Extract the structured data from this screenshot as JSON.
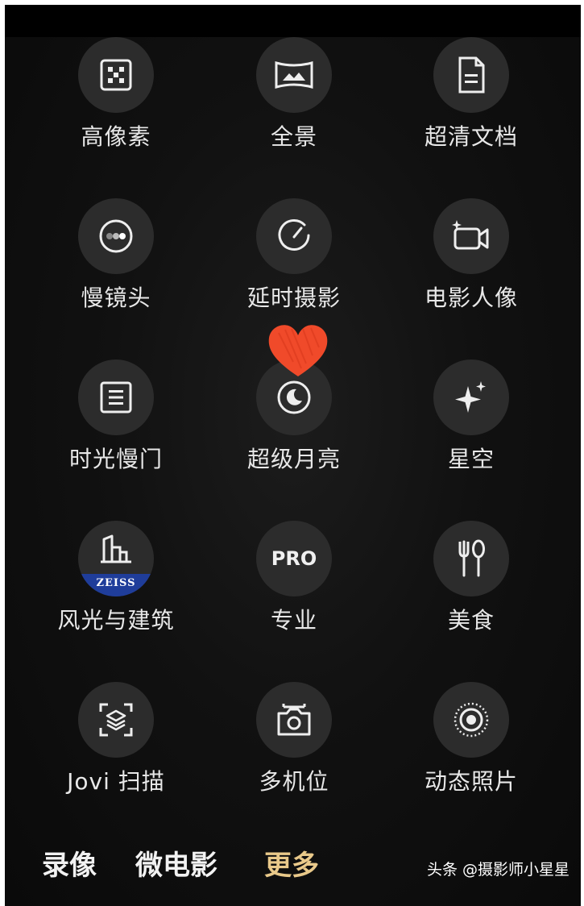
{
  "modes": [
    {
      "label": "高像素",
      "icon": "high-pixel-grid-icon"
    },
    {
      "label": "全景",
      "icon": "panorama-icon"
    },
    {
      "label": "超清文档",
      "icon": "document-icon"
    },
    {
      "label": "慢镜头",
      "icon": "slow-motion-icon"
    },
    {
      "label": "延时摄影",
      "icon": "timelapse-gauge-icon"
    },
    {
      "label": "电影人像",
      "icon": "movie-camera-sparkle-icon"
    },
    {
      "label": "时光慢门",
      "icon": "slow-shutter-list-icon"
    },
    {
      "label": "超级月亮",
      "icon": "moon-icon"
    },
    {
      "label": "星空",
      "icon": "sparkle-star-icon"
    },
    {
      "label": "风光与建筑",
      "icon": "building-icon",
      "badge": "ZEISS"
    },
    {
      "label": "专业",
      "icon": "pro-text-icon",
      "icon_text": "PRO"
    },
    {
      "label": "美食",
      "icon": "fork-spoon-icon"
    },
    {
      "label": "Jovi 扫描",
      "icon": "scan-icon"
    },
    {
      "label": "多机位",
      "icon": "multi-camera-icon"
    },
    {
      "label": "动态照片",
      "icon": "live-photo-icon"
    }
  ],
  "bottom_tabs": [
    {
      "label": "录像",
      "active": false
    },
    {
      "label": "微电影",
      "active": false
    },
    {
      "label": "更多",
      "active": true
    }
  ],
  "watermark": "头条 @摄影师小星星",
  "colors": {
    "active_tab": "#e9c98a",
    "icon_bg": "#2c2c2c",
    "zeiss_blue": "#1f3d9a",
    "heart": "#f04a2a"
  }
}
